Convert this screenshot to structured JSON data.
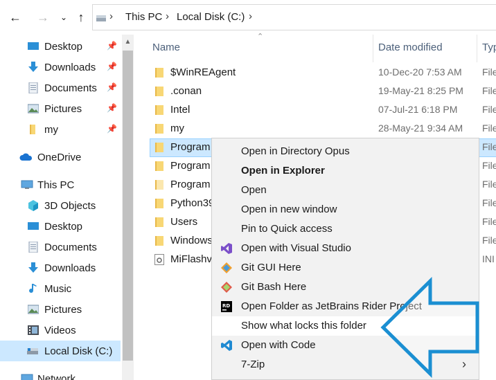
{
  "address": {
    "crumbs": [
      "This PC",
      "Local Disk (C:)"
    ]
  },
  "sidebar": {
    "quick_access": [
      {
        "label": "Desktop",
        "icon": "desktop-icon",
        "pinned": true
      },
      {
        "label": "Downloads",
        "icon": "downloads-icon",
        "pinned": true
      },
      {
        "label": "Documents",
        "icon": "documents-icon",
        "pinned": true
      },
      {
        "label": "Pictures",
        "icon": "pictures-icon",
        "pinned": true
      },
      {
        "label": "my",
        "icon": "folder-icon",
        "pinned": true
      }
    ],
    "onedrive": "OneDrive",
    "this_pc": "This PC",
    "pc_items": [
      "3D Objects",
      "Desktop",
      "Documents",
      "Downloads",
      "Music",
      "Pictures",
      "Videos",
      "Local Disk (C:)"
    ],
    "network": "Network"
  },
  "columns": {
    "name": "Name",
    "date": "Date modified",
    "type": "Typ"
  },
  "files": [
    {
      "name": "$WinREAgent",
      "date": "10-Dec-20 7:53 AM",
      "type": "File"
    },
    {
      "name": ".conan",
      "date": "19-May-21 8:25 PM",
      "type": "File"
    },
    {
      "name": "Intel",
      "date": "07-Jul-21 6:18 PM",
      "type": "File"
    },
    {
      "name": "my",
      "date": "28-May-21 9:34 AM",
      "type": "File"
    },
    {
      "name": "Program",
      "date": "",
      "type": "File"
    },
    {
      "name": "Program",
      "date": "",
      "type": "File"
    },
    {
      "name": "Program",
      "date": "",
      "type": "File"
    },
    {
      "name": "Python39",
      "date": "",
      "type": "File"
    },
    {
      "name": "Users",
      "date": "",
      "type": "File"
    },
    {
      "name": "Windows",
      "date": "",
      "type": "File"
    },
    {
      "name": "MiFlashv",
      "date": "",
      "type": "INI"
    }
  ],
  "context_menu": {
    "items": [
      {
        "label": "Open in Directory Opus"
      },
      {
        "label": "Open in Explorer",
        "bold": true
      },
      {
        "label": "Open"
      },
      {
        "label": "Open in new window"
      },
      {
        "label": "Pin to Quick access"
      },
      {
        "label": "Open with Visual Studio",
        "icon": "visual-studio-icon"
      },
      {
        "label": "Git GUI Here",
        "icon": "git-gui-icon"
      },
      {
        "label": "Git Bash Here",
        "icon": "git-bash-icon"
      },
      {
        "label": "Open Folder as JetBrains Rider Project",
        "icon": "rider-icon"
      },
      {
        "label": "Show what locks this folder",
        "hover": true
      },
      {
        "label": "Open with Code",
        "icon": "vscode-icon"
      },
      {
        "label": "7-Zip",
        "submenu": true
      }
    ]
  },
  "colors": {
    "selection": "#cce8ff",
    "menu_bg": "#f2f2f2",
    "arrow": "#1b8fd2",
    "folder": "#f8d775"
  }
}
